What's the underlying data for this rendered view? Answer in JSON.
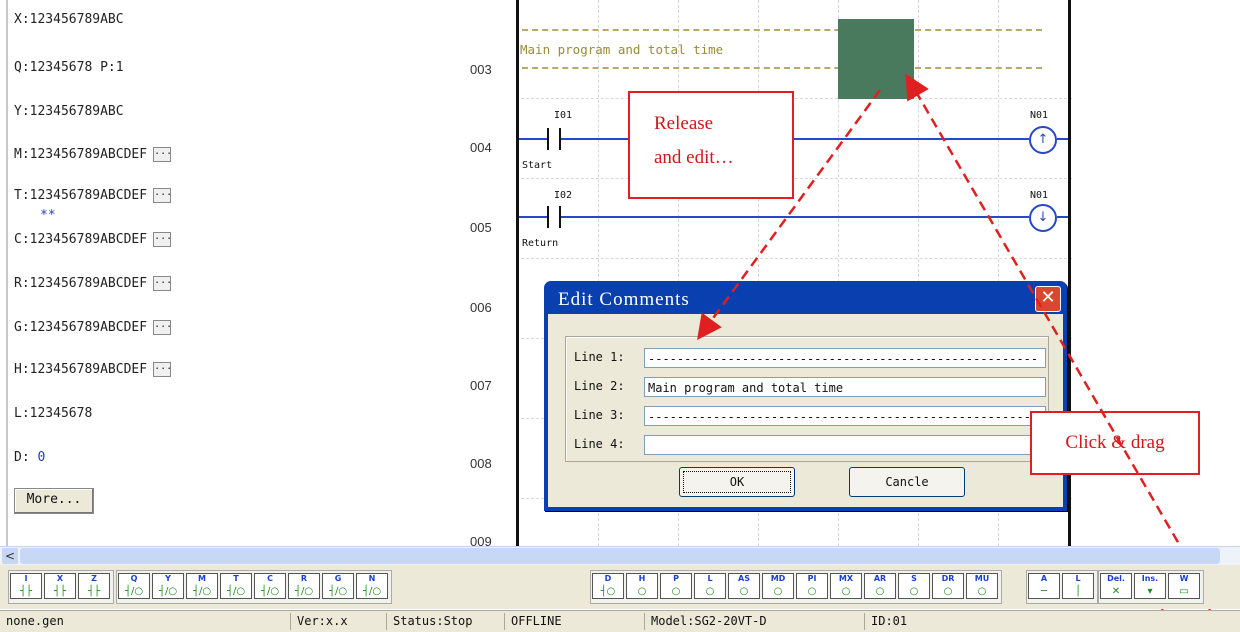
{
  "variables": [
    {
      "name": "X",
      "text": "X:123456789ABC",
      "has_more": false
    },
    {
      "name": "Q",
      "text": "Q:12345678 P:1",
      "has_more": false
    },
    {
      "name": "Y",
      "text": "Y:123456789ABC",
      "has_more": false
    },
    {
      "name": "M",
      "text": "M:123456789ABCDEF",
      "has_more": true
    },
    {
      "name": "T",
      "text": "T:123456789ABCDEF",
      "has_more": true
    },
    {
      "name": "C",
      "text": "C:123456789ABCDEF",
      "has_more": true
    },
    {
      "name": "R",
      "text": "R:123456789ABCDEF",
      "has_more": true
    },
    {
      "name": "G",
      "text": "G:123456789ABCDEF",
      "has_more": true
    },
    {
      "name": "H",
      "text": "H:123456789ABCDEF",
      "has_more": true
    },
    {
      "name": "L",
      "text": "L:12345678",
      "has_more": false
    },
    {
      "name": "D",
      "text": "D:",
      "value": "0",
      "has_more": false
    }
  ],
  "ellipsis_label": "...",
  "stars": "**",
  "more_button": "More...",
  "row_numbers": [
    "003",
    "004",
    "005",
    "006",
    "007",
    "008",
    "009"
  ],
  "ladder": {
    "comment_text": "Main program and total time",
    "rung4": {
      "contact": "I01",
      "contact_label": "Start",
      "coil": "N01",
      "coil_symbol": "↑"
    },
    "rung5": {
      "contact": "I02",
      "contact_label": "Return",
      "coil": "N01",
      "coil_symbol": "↓"
    }
  },
  "annotations": {
    "release_line1": "Release",
    "release_line2": "and edit…",
    "click_drag": "Click & drag"
  },
  "dialog": {
    "title": "Edit Comments",
    "close_glyph": "✕",
    "lines": [
      {
        "label": "Line 1:",
        "value": "------------------------------------------------------"
      },
      {
        "label": "Line 2:",
        "value": "Main program and total time"
      },
      {
        "label": "Line 3:",
        "value": "------------------------------------------------------"
      },
      {
        "label": "Line 4:",
        "value": ""
      }
    ],
    "ok_label": "OK",
    "cancel_label": "Cancle"
  },
  "scrollbar": {
    "left_arrow": "<"
  },
  "toolbar": {
    "buttons": [
      {
        "name": "contact-I",
        "sub": "I",
        "sym": "┤├"
      },
      {
        "name": "contact-X",
        "sub": "X",
        "sym": "┤├"
      },
      {
        "name": "contact-Z",
        "sub": "Z",
        "sym": "┤├"
      },
      {
        "name": "coil-Q",
        "sub": "Q",
        "sym": "┤/○"
      },
      {
        "name": "coil-Y",
        "sub": "Y",
        "sym": "┤/○"
      },
      {
        "name": "coil-M",
        "sub": "M",
        "sym": "┤/○"
      },
      {
        "name": "coil-T",
        "sub": "T",
        "sym": "┤/○"
      },
      {
        "name": "coil-C",
        "sub": "C",
        "sym": "┤/○"
      },
      {
        "name": "coil-R",
        "sub": "R",
        "sym": "┤/○"
      },
      {
        "name": "coil-G",
        "sub": "G",
        "sym": "┤/○"
      },
      {
        "name": "coil-N",
        "sub": "N",
        "sym": "┤/○"
      },
      {
        "name": "func-D",
        "sub": "D",
        "sym": "┤○"
      },
      {
        "name": "func-H",
        "sub": "H",
        "sym": "○"
      },
      {
        "name": "func-P",
        "sub": "P",
        "sym": "○"
      },
      {
        "name": "func-L",
        "sub": "L",
        "sym": "○"
      },
      {
        "name": "func-AS",
        "sub": "AS",
        "sym": "○"
      },
      {
        "name": "func-MD",
        "sub": "MD",
        "sym": "○"
      },
      {
        "name": "func-PI",
        "sub": "PI",
        "sym": "○"
      },
      {
        "name": "func-MX",
        "sub": "MX",
        "sym": "○"
      },
      {
        "name": "func-AR",
        "sub": "AR",
        "sym": "○"
      },
      {
        "name": "func-S",
        "sub": "S",
        "sym": "○"
      },
      {
        "name": "func-DR",
        "sub": "DR",
        "sym": "○"
      },
      {
        "name": "func-MU",
        "sub": "MU",
        "sym": "○"
      },
      {
        "name": "hline",
        "sub": "A",
        "sym": "─"
      },
      {
        "name": "vline",
        "sub": "L",
        "sym": "│"
      },
      {
        "name": "delete",
        "sub": "Del.",
        "sym": "✕"
      },
      {
        "name": "insert",
        "sub": "Ins.",
        "sym": "▾"
      },
      {
        "name": "comment",
        "sub": "W",
        "sym": "▭"
      }
    ]
  },
  "status": {
    "file": "none.gen",
    "version": "Ver:x.x",
    "status": "Status:Stop",
    "mode": "OFFLINE",
    "model": "Model:SG2-20VT-D",
    "id": "ID:01"
  }
}
